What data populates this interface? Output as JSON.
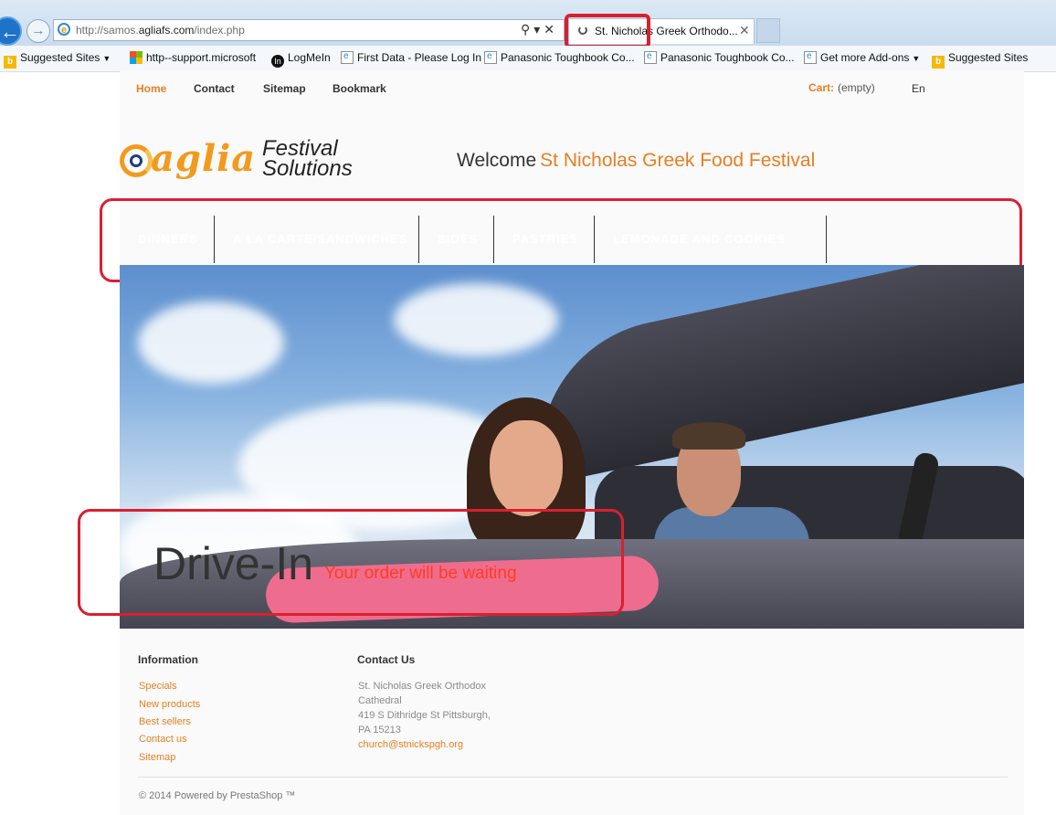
{
  "browser": {
    "url_prefix": "http://samos.",
    "url_domain": "agliafs.com",
    "url_path": "/index.php",
    "tab_title": "St. Nicholas Greek Orthodo...",
    "favorites": [
      {
        "label": "Suggested Sites",
        "icon": "bing-icon"
      },
      {
        "label": "http--support.microsoft",
        "icon": "microsoft-icon"
      },
      {
        "label": "LogMeIn",
        "icon": "logmein-icon"
      },
      {
        "label": "First Data - Please Log In",
        "icon": "page-icon"
      },
      {
        "label": "Panasonic Toughbook Co...",
        "icon": "page-icon"
      },
      {
        "label": "Panasonic Toughbook Co...",
        "icon": "page-icon"
      },
      {
        "label": "Get more Add-ons",
        "icon": "page-icon"
      },
      {
        "label": "Suggested Sites",
        "icon": "bing-icon"
      }
    ]
  },
  "topnav": {
    "items": [
      "Home",
      "Contact",
      "Sitemap",
      "Bookmark"
    ],
    "cart_label": "Cart:",
    "cart_value": "(empty)",
    "language": "En"
  },
  "logo": {
    "word": "aglia",
    "line1": "Festival",
    "line2": "Solutions"
  },
  "header": {
    "welcome": "Welcome",
    "festival_name": "St Nicholas Greek Food Festival"
  },
  "menu": {
    "categories": [
      "Dinners",
      "A La Carte/Sandwiches",
      "Sides",
      "Pastries",
      "Lemonade and Cookies"
    ]
  },
  "hero": {
    "title": "Drive-In",
    "subtitle": "Your order will be waiting"
  },
  "footer": {
    "info_heading": "Information",
    "info_links": [
      "Specials",
      "New products",
      "Best sellers",
      "Contact us",
      "Sitemap"
    ],
    "contact_heading": "Contact Us",
    "address_lines": [
      "St. Nicholas Greek Orthodox",
      "Cathedral",
      "419 S Dithridge St Pittsburgh,",
      "PA 15213"
    ],
    "email": "church@stnickspgh.org",
    "copyright": "© 2014 Powered by PrestaShop ™"
  },
  "colors": {
    "accent_orange": "#e67e22",
    "hero_subtitle": "#ff3d1f",
    "annotation_red": "#d92030"
  }
}
